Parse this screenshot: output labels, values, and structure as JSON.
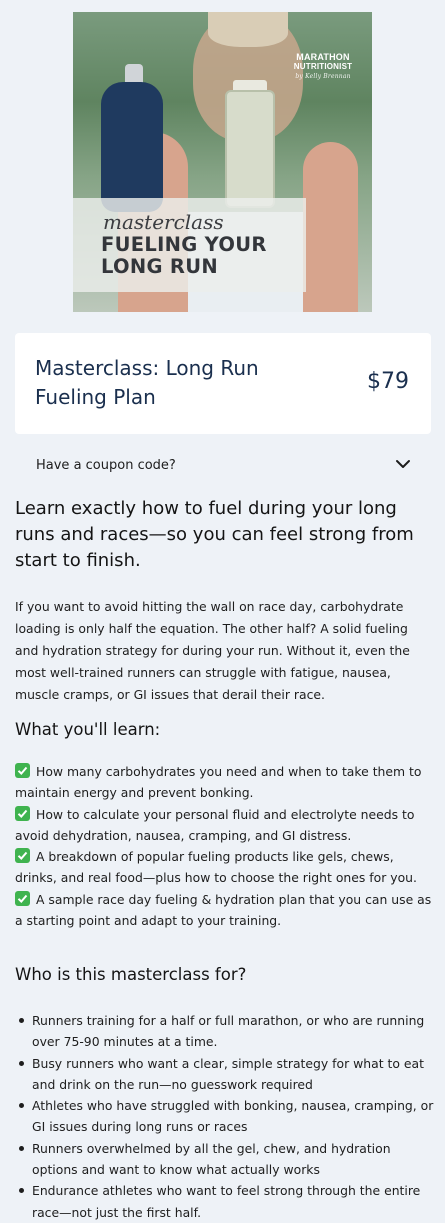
{
  "hero": {
    "brand_line1": "MARATHON",
    "brand_line2": "NUTRITIONIST",
    "brand_script": "by Kelly Brennan",
    "script_word": "masterclass",
    "headline_line1": "FUELING YOUR",
    "headline_line2": "LONG RUN"
  },
  "product": {
    "title": "Masterclass: Long Run Fueling Plan",
    "price": "$79"
  },
  "coupon": {
    "label": "Have a coupon code?"
  },
  "content": {
    "intro": "Learn exactly how to fuel during your long runs and races—so you can feel strong from start to finish.",
    "paragraph": "If you want to avoid hitting the wall on race day, carbohydrate loading is only half the equation. The other half? A solid fueling and hydration strategy for during your run. Without it, even the most well-trained runners can struggle with fatigue, nausea, muscle cramps, or GI issues that derail their race.",
    "learn_heading": "What you'll learn:",
    "learn_items": [
      "How many carbohydrates you need and when to take them to maintain energy and prevent bonking.",
      "How to calculate your personal fluid and electrolyte needs to avoid dehydration, nausea, cramping, and GI distress.",
      "A breakdown of popular fueling products like gels, chews, drinks, and real food—plus how to choose the right ones for you.",
      "A sample race day fueling & hydration plan that you can use as a starting point and adapt to your training."
    ],
    "who_heading": "Who is this masterclass for?",
    "who_items": [
      "Runners training for a half or full marathon, or who are running over 75-90 minutes at a time.",
      "Busy runners who want a clear, simple strategy for what to eat and drink on the run—no guesswork required",
      "Athletes who have struggled with bonking, nausea, cramping, or GI issues during long runs or races",
      "Runners overwhelmed by all the gel, chew, and hydration options and want to know what actually works",
      "Endurance athletes who want to feel strong through the entire race—not just the first half."
    ]
  },
  "colors": {
    "background": "#eef2f7",
    "card": "#ffffff",
    "title_navy": "#1a2f4e",
    "check_green": "#3fb34f"
  },
  "icons": {
    "coupon_toggle": "chevron-down-icon",
    "learn_bullet": "check-mark-icon"
  }
}
